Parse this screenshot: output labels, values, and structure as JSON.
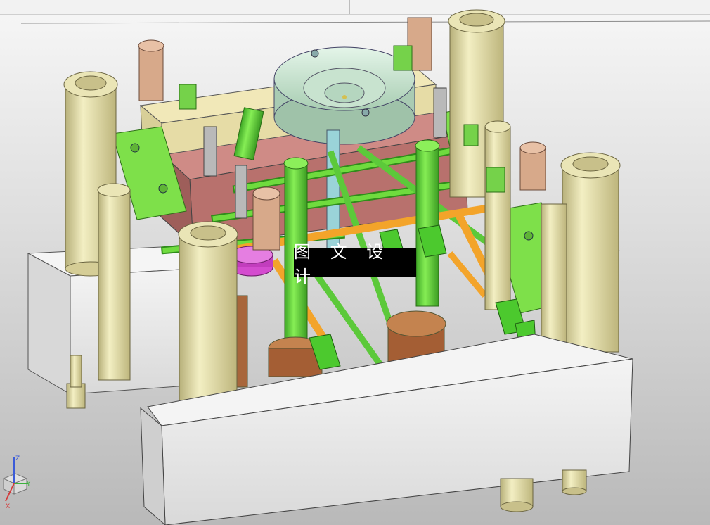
{
  "watermark": {
    "text": "图 文 设 计"
  },
  "triad": {
    "axis_y": "Y",
    "axis_x": "X",
    "axis_z": "Z"
  },
  "colors": {
    "base_plate": "#e9e9e9",
    "guide_pillar": "#e8e3ad",
    "cooling_green": "#5fd43c",
    "cooling_orange": "#f3a42a",
    "cavity_red": "#c57b76",
    "locating_ring": "#cfe9d6",
    "magenta_insert": "#d44ccf",
    "brown_core": "#b86b3f"
  }
}
